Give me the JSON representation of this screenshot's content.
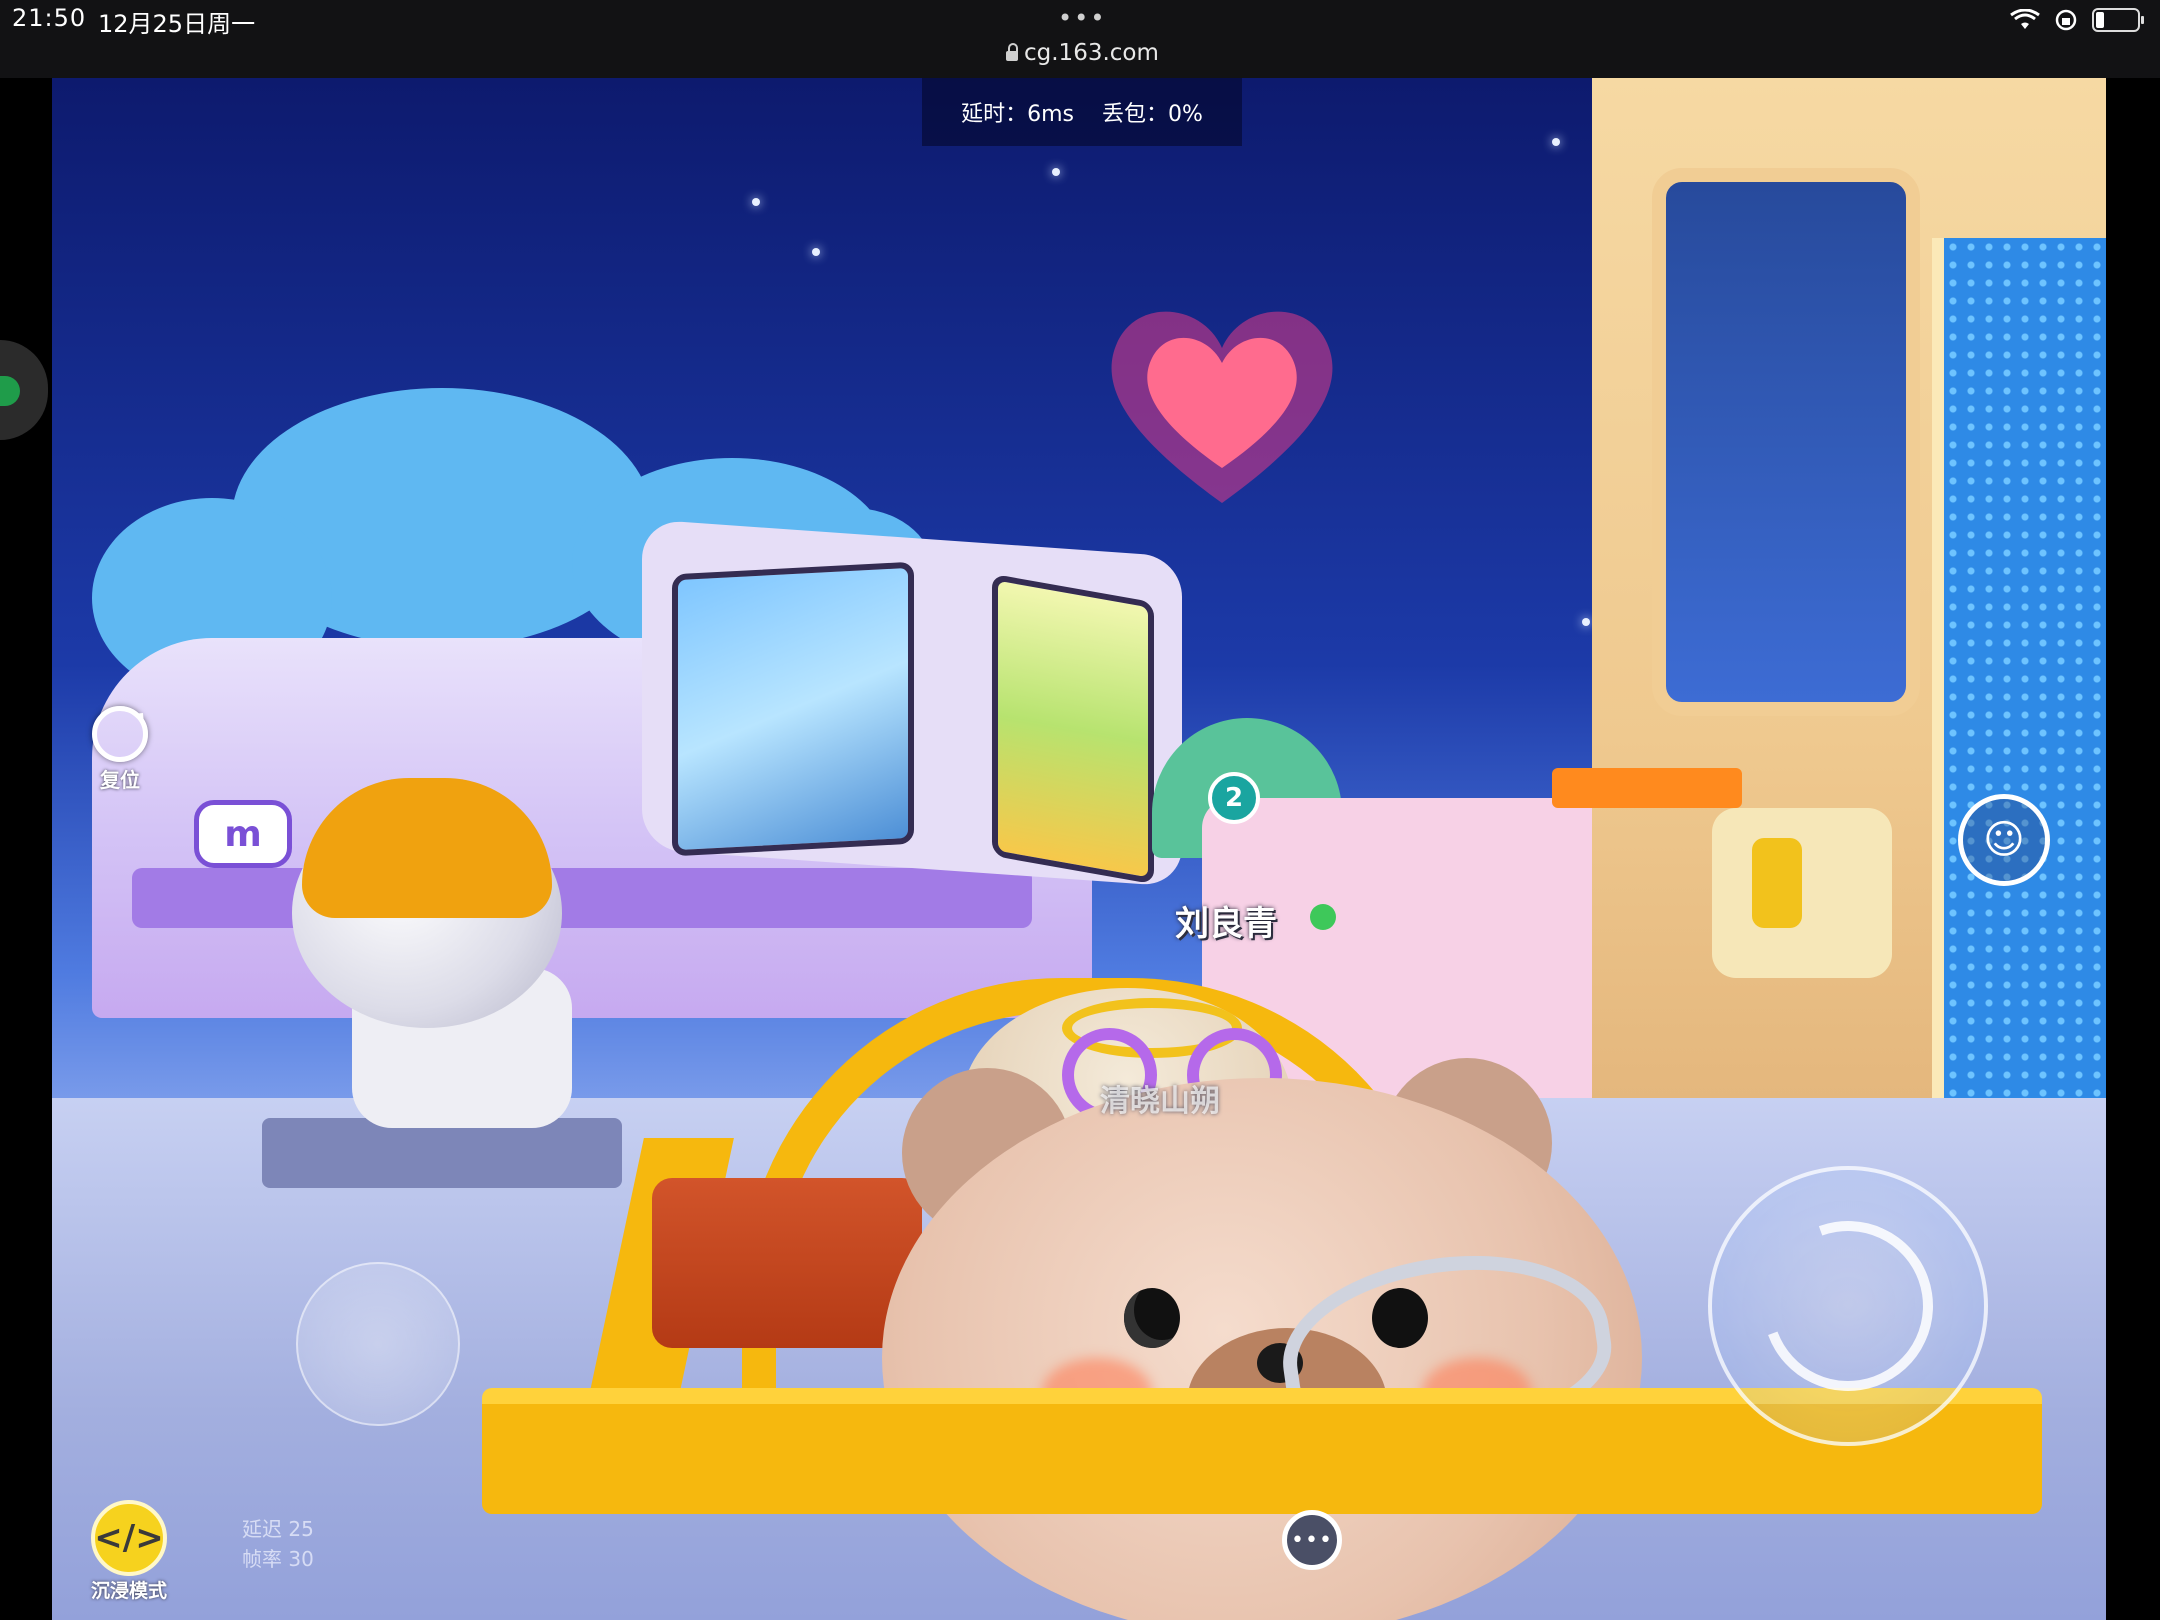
{
  "status_bar": {
    "time": "21:50",
    "date": "12月25日周一",
    "more_dots": "•••",
    "url": "cg.163.com"
  },
  "hud": {
    "latency_label": "延时：6ms",
    "packet_loss_label": "丢包：0%",
    "reset_label": "复位",
    "immersive_label": "沉浸模式",
    "immersive_glyph": "</>",
    "perf_line1": "延迟 25",
    "perf_line2": "帧率 30",
    "badge_number": "2",
    "chat_glyph": "•••",
    "sound_glyph": "☺"
  },
  "players": {
    "main_name": "刘良青",
    "sub_name": "清晓山朔"
  },
  "scene": {
    "billboard_sign": "m",
    "accent_colors": {
      "sky_top": "#0d1a6e",
      "cart_yellow": "#f6b80e",
      "heart_pink": "#ff5f8f",
      "status_green": "#1f9c4a"
    }
  }
}
